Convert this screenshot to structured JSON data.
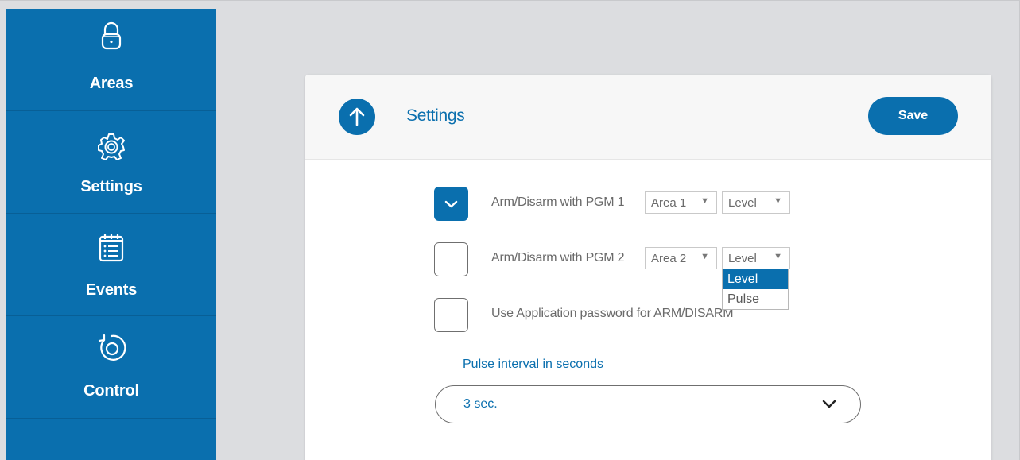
{
  "sidebar": {
    "items": [
      {
        "label": "Areas",
        "icon": "lock-icon"
      },
      {
        "label": "Settings",
        "icon": "gear-icon"
      },
      {
        "label": "Events",
        "icon": "calendar-list-icon"
      },
      {
        "label": "Control",
        "icon": "rotate-control-icon"
      }
    ]
  },
  "header": {
    "title": "Settings",
    "back_icon": "arrow-up-icon",
    "save_label": "Save"
  },
  "options": [
    {
      "label": "Arm/Disarm with PGM 1",
      "checked": true,
      "area": "Area 1",
      "mode": "Level"
    },
    {
      "label": "Arm/Disarm with PGM 2",
      "checked": false,
      "area": "Area 2",
      "mode": "Level"
    },
    {
      "label": "Use Application password for ARM/DISARM",
      "checked": false
    }
  ],
  "mode_menu": {
    "items": [
      {
        "label": "Level",
        "selected": true
      },
      {
        "label": "Pulse",
        "selected": false
      }
    ]
  },
  "pulse": {
    "label": "Pulse interval in seconds",
    "value": "3 sec."
  },
  "colors": {
    "accent": "#0a6fae",
    "background": "#dcdde0"
  }
}
